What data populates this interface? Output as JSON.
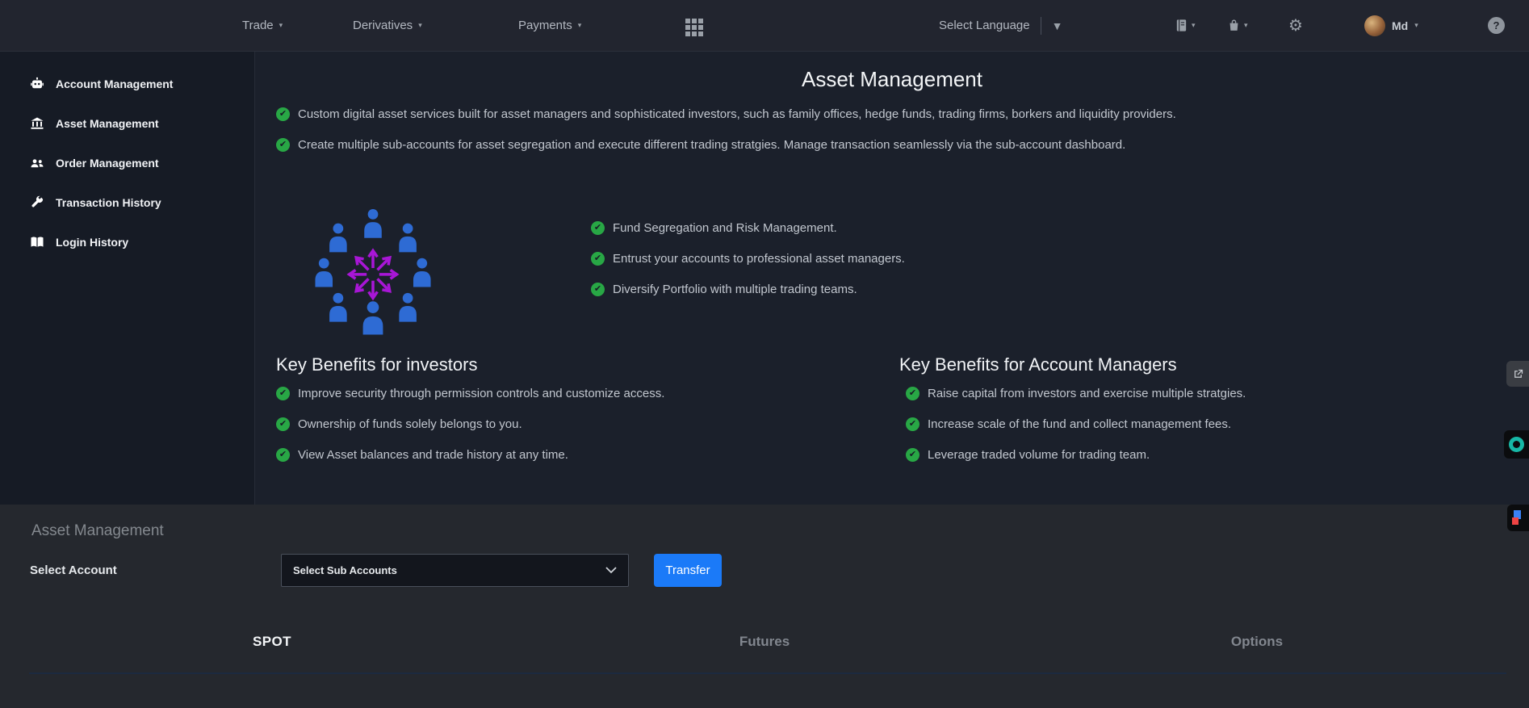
{
  "topbar": {
    "nav_items": [
      {
        "label": "Trade"
      },
      {
        "label": "Derivatives"
      },
      {
        "label": "Payments"
      }
    ],
    "language_selector": "Select Language",
    "username": "Md"
  },
  "icons": {
    "caret_small": "▾",
    "caret_filled": "▼",
    "gear": "⚙",
    "question": "?",
    "check": "✔",
    "chevron_down": "∨"
  },
  "sidebar": {
    "items": [
      {
        "label": "Account Management"
      },
      {
        "label": "Asset Management"
      },
      {
        "label": "Order Management"
      },
      {
        "label": "Transaction History"
      },
      {
        "label": "Login History"
      }
    ]
  },
  "main": {
    "title": "Asset Management",
    "intro_bullets": [
      "Custom digital asset services built for asset managers and sophisticated investors, such as family offices, hedge funds, trading firms, borkers and liquidity providers.",
      "Create multiple sub-accounts for asset segregation and execute different trading stratgies. Manage transaction seamlessly via the sub-account dashboard."
    ],
    "feature_bullets": [
      "Fund Segregation and Risk Management.",
      "Entrust your accounts to professional asset managers.",
      "Diversify Portfolio with multiple trading teams."
    ],
    "benefits_investors": {
      "heading": "Key Benefits for investors",
      "bullets": [
        "Improve security through permission controls and customize access.",
        "Ownership of funds solely belongs to you.",
        "View Asset balances and trade history at any time."
      ]
    },
    "benefits_managers": {
      "heading": "Key Benefits for Account Managers",
      "bullets": [
        "Raise capital from investors and exercise multiple stratgies.",
        "Increase scale of the fund and collect management fees.",
        "Leverage traded volume for trading team."
      ]
    }
  },
  "transfer_panel": {
    "heading": "Asset Management",
    "select_account_label": "Select Account",
    "dropdown_value": "Select Sub Accounts",
    "transfer_button": "Transfer",
    "tabs": [
      {
        "label": "SPOT"
      },
      {
        "label": "Futures"
      },
      {
        "label": "Options"
      }
    ]
  },
  "colors": {
    "accent_blue": "#1b7af8",
    "check_green": "#28a745",
    "people_blue": "#2e6bd4",
    "arrows_magenta": "#a816d6",
    "panel_bg": "#25282e",
    "main_bg": "#1b202b"
  }
}
